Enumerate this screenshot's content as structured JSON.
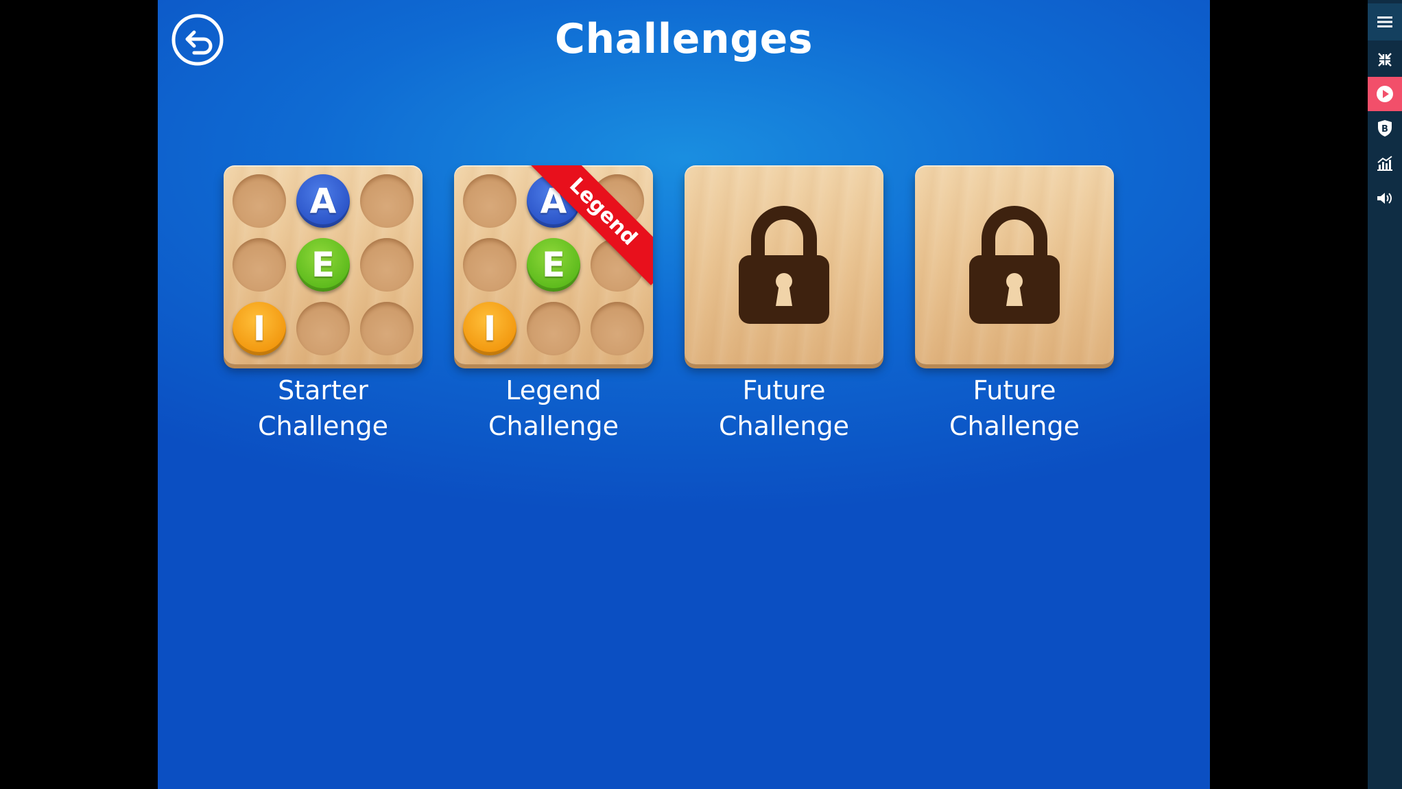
{
  "header": {
    "title": "Challenges"
  },
  "challenges": [
    {
      "line1": "Starter",
      "line2": "Challenge",
      "locked": false,
      "ribbon": "",
      "grid": [
        "",
        "A",
        "",
        "",
        "E",
        "",
        "I",
        "",
        ""
      ]
    },
    {
      "line1": "Legend",
      "line2": "Challenge",
      "locked": false,
      "ribbon": "Legend",
      "grid": [
        "",
        "A",
        "",
        "",
        "E",
        "",
        "I",
        "",
        ""
      ]
    },
    {
      "line1": "Future",
      "line2": "Challenge",
      "locked": true,
      "ribbon": ""
    },
    {
      "line1": "Future",
      "line2": "Challenge",
      "locked": true,
      "ribbon": ""
    }
  ],
  "balls": {
    "A": "blue",
    "E": "green",
    "I": "orange"
  },
  "colors": {
    "background": "#0f6bd3",
    "ribbon": "#e8101c",
    "lock": "#3e220f",
    "sidebar": "#0f2d44",
    "sidebar_active": "#f24f6a"
  },
  "sidebar": {
    "items": [
      {
        "icon": "hamburger-menu-icon"
      },
      {
        "icon": "collapse-arrows-icon"
      },
      {
        "icon": "play-icon"
      },
      {
        "icon": "shield-b-icon"
      },
      {
        "icon": "chart-icon"
      },
      {
        "icon": "speaker-icon"
      }
    ]
  }
}
